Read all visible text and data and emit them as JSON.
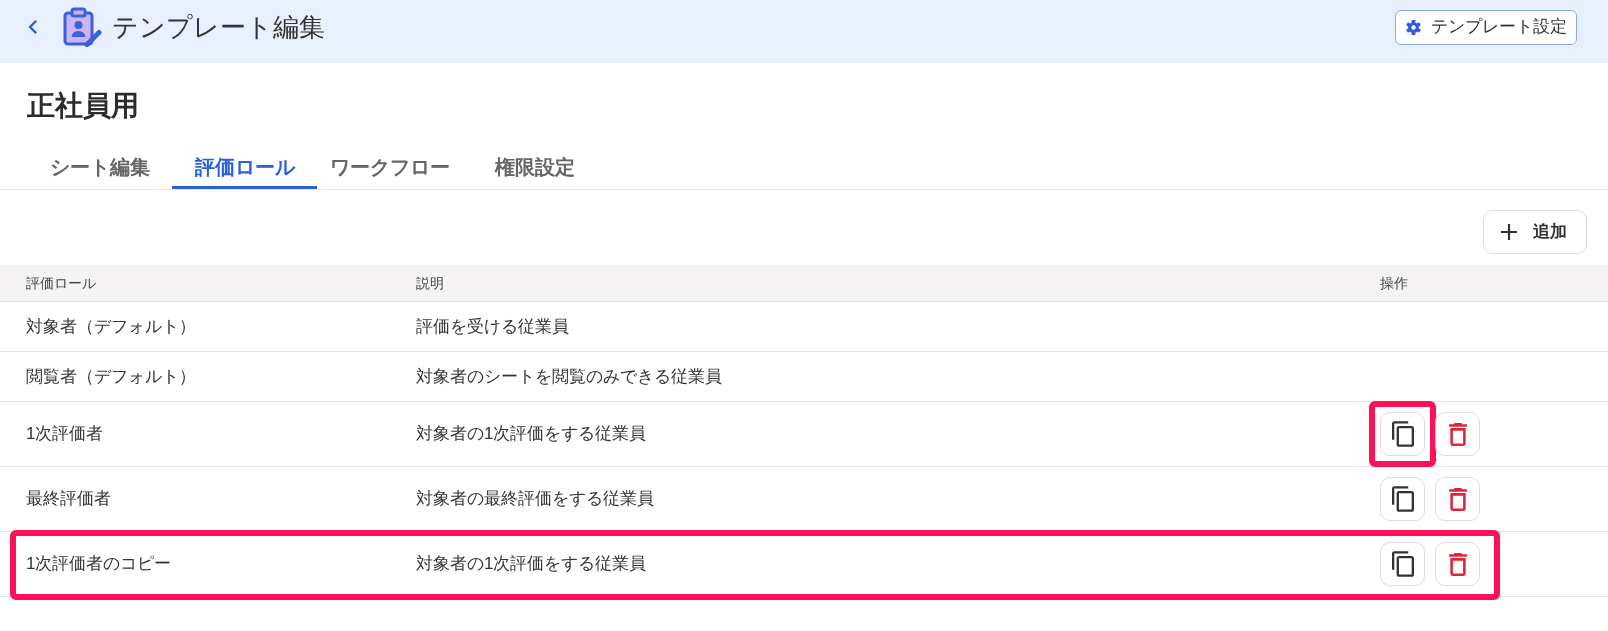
{
  "header": {
    "title": "テンプレート編集",
    "settings_button": "テンプレート設定"
  },
  "page_title": "正社員用",
  "tabs": [
    {
      "label": "シート編集",
      "selected": false
    },
    {
      "label": "評価ロール",
      "selected": true
    },
    {
      "label": "ワークフロー",
      "selected": false
    },
    {
      "label": "権限設定",
      "selected": false
    }
  ],
  "toolbar": {
    "add_button": "追加"
  },
  "table": {
    "columns": [
      "評価ロール",
      "説明",
      "操作"
    ],
    "rows": [
      {
        "role": "対象者（デフォルト）",
        "description": "評価を受ける従業員",
        "highlighted": false
      },
      {
        "role": "閲覧者（デフォルト）",
        "description": "対象者のシートを閲覧のみできる従業員",
        "highlighted": false
      },
      {
        "role": "1次評価者",
        "description": "対象者の1次評価をする従業員",
        "highlighted": false,
        "actions": [
          {
            "kind": "copy",
            "highlighted": true
          },
          {
            "kind": "delete",
            "highlighted": false
          }
        ]
      },
      {
        "role": "最終評価者",
        "description": "対象者の最終評価をする従業員",
        "highlighted": false,
        "actions": [
          {
            "kind": "copy",
            "highlighted": false
          },
          {
            "kind": "delete",
            "highlighted": false
          }
        ]
      },
      {
        "role": "1次評価者のコピー",
        "description": "対象者の1次評価をする従業員",
        "highlighted": true,
        "actions": [
          {
            "kind": "copy",
            "highlighted": false
          },
          {
            "kind": "delete",
            "highlighted": false
          }
        ]
      }
    ]
  }
}
